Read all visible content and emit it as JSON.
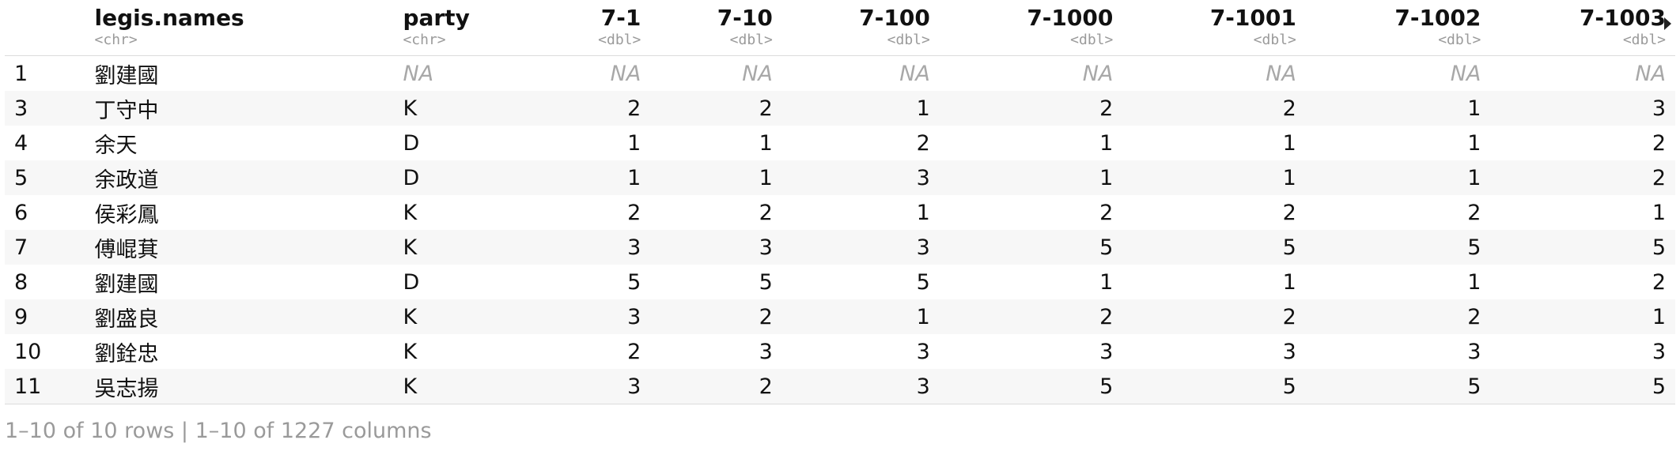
{
  "columns": [
    {
      "name": "",
      "type": "",
      "align": "left"
    },
    {
      "name": "legis.names",
      "type": "<chr>",
      "align": "left"
    },
    {
      "name": "party",
      "type": "<chr>",
      "align": "left"
    },
    {
      "name": "7-1",
      "type": "<dbl>",
      "align": "right"
    },
    {
      "name": "7-10",
      "type": "<dbl>",
      "align": "right"
    },
    {
      "name": "7-100",
      "type": "<dbl>",
      "align": "right"
    },
    {
      "name": "7-1000",
      "type": "<dbl>",
      "align": "right"
    },
    {
      "name": "7-1001",
      "type": "<dbl>",
      "align": "right"
    },
    {
      "name": "7-1002",
      "type": "<dbl>",
      "align": "right"
    },
    {
      "name": "7-1003",
      "type": "<dbl>",
      "align": "right"
    }
  ],
  "rows": [
    [
      "1",
      "劉建國",
      "NA",
      "NA",
      "NA",
      "NA",
      "NA",
      "NA",
      "NA",
      "NA"
    ],
    [
      "3",
      "丁守中",
      "K",
      "2",
      "2",
      "1",
      "2",
      "2",
      "1",
      "3"
    ],
    [
      "4",
      "余天",
      "D",
      "1",
      "1",
      "2",
      "1",
      "1",
      "1",
      "2"
    ],
    [
      "5",
      "余政道",
      "D",
      "1",
      "1",
      "3",
      "1",
      "1",
      "1",
      "2"
    ],
    [
      "6",
      "侯彩鳳",
      "K",
      "2",
      "2",
      "1",
      "2",
      "2",
      "2",
      "1"
    ],
    [
      "7",
      "傅崐萁",
      "K",
      "3",
      "3",
      "3",
      "5",
      "5",
      "5",
      "5"
    ],
    [
      "8",
      "劉建國",
      "D",
      "5",
      "5",
      "5",
      "1",
      "1",
      "1",
      "2"
    ],
    [
      "9",
      "劉盛良",
      "K",
      "3",
      "2",
      "1",
      "2",
      "2",
      "2",
      "1"
    ],
    [
      "10",
      "劉銓忠",
      "K",
      "2",
      "3",
      "3",
      "3",
      "3",
      "3",
      "3"
    ],
    [
      "11",
      "吳志揚",
      "K",
      "3",
      "2",
      "3",
      "5",
      "5",
      "5",
      "5"
    ]
  ],
  "na_label": "NA",
  "footer": {
    "text": "1–10 of 10 rows | 1–10 of 1227 columns"
  },
  "next_columns_icon": "triangle-right-icon"
}
